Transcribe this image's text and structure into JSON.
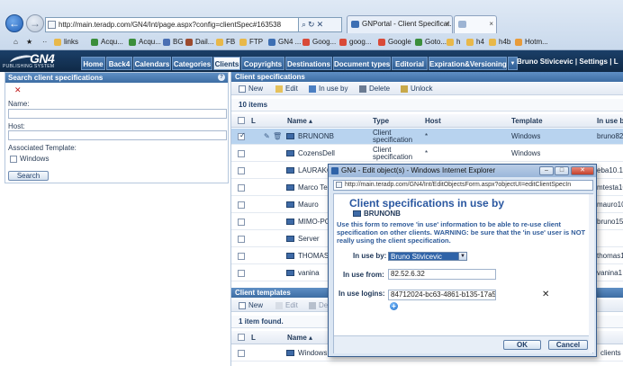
{
  "browser": {
    "address": "http://main.teradp.com/GN4/Int/page.aspx?config=clientSpec#163538",
    "tabs": [
      {
        "label": "GNPortal - Client Specificat...",
        "close": "×"
      },
      {
        "label": "",
        "close": "×"
      }
    ],
    "bookmarks": [
      "links",
      "Acqu...",
      "Acqu...",
      "BG",
      "Dail...",
      "FB",
      "FTP",
      "GN4 ...",
      "Goog...",
      "goog...",
      "Google",
      "Goto...",
      "h",
      "h4",
      "h4b",
      "Hotm..."
    ],
    "colors": {
      "chrome": "#c9d9ec",
      "address_border": "#7f9db9"
    }
  },
  "app": {
    "logo": {
      "title": "GN4",
      "subtitle": "PUBLISHING SYSTEM"
    },
    "nav_tabs": [
      "Home",
      "Back4",
      "Calendars",
      "Categories",
      "Clients",
      "Copyrights",
      "Destinations",
      "Document types",
      "Editorial",
      "Expiration&Versioning",
      "▼"
    ],
    "selected_tab": "Clients",
    "user": {
      "name": "Bruno Stivicevic",
      "sep": "|",
      "settings": "Settings",
      "sep2": "|",
      "more": "L"
    },
    "colors": {
      "header": "#0f2946",
      "panel_title": "#3d6da3",
      "selection": "#b8d3ef"
    }
  },
  "search_panel": {
    "title": "Search client specifications",
    "name_label": "Name:",
    "host_label": "Host:",
    "template_label": "Associated Template:",
    "template_option": "Windows",
    "search_button": "Search"
  },
  "client_specs": {
    "title": "Client specifications",
    "toolbar": {
      "new": "New",
      "edit": "Edit",
      "in_use_by": "In use by",
      "delete": "Delete",
      "unlock": "Unlock"
    },
    "count": "10 items",
    "columns": {
      "l": "L",
      "name": "Name ▴",
      "type": "Type",
      "host": "Host",
      "template": "Template",
      "in_use_by": "In use by"
    },
    "rows": [
      {
        "name": "BRUNONB",
        "type": "Client specification",
        "host": "*",
        "template": "Windows",
        "in_use": "bruno82..."
      },
      {
        "name": "CozensDell",
        "type": "Client specification",
        "host": "*",
        "template": "Windows",
        "in_use": ""
      },
      {
        "name": "LAURAKOV",
        "type": "",
        "host": "",
        "template": "",
        "in_use": "eba10.1"
      },
      {
        "name": "Marco Tes",
        "type": "",
        "host": "",
        "template": "",
        "in_use": "mtesta10"
      },
      {
        "name": "Mauro",
        "type": "",
        "host": "",
        "template": "",
        "in_use": "mauro10"
      },
      {
        "name": "MIMO-PC",
        "type": "",
        "host": "",
        "template": "",
        "in_use": "bruno151"
      },
      {
        "name": "Server",
        "type": "",
        "host": "",
        "template": "",
        "in_use": ""
      },
      {
        "name": "THOMASD",
        "type": "",
        "host": "",
        "template": "",
        "in_use": "thomas1"
      },
      {
        "name": "vanina",
        "type": "",
        "host": "",
        "template": "",
        "in_use": "vanina1"
      }
    ]
  },
  "client_templates": {
    "title": "Client templates",
    "toolbar": {
      "new": "New",
      "edit": "Edit",
      "delete": "De"
    },
    "count": "1 item found.",
    "columns": {
      "l": "L",
      "name": "Name ▴"
    },
    "rows": [
      {
        "name": "Windows",
        "extra": "clients"
      }
    ]
  },
  "dialog": {
    "window_title": "GN4 - Edit object(s) - Windows Internet Explorer",
    "address": "http://main.teradp.com/GN4/Int/EditObjectsForm.aspx?objectUI=editClientSpecIn",
    "heading": "Client specifications in use by",
    "subject": "BRUNONB",
    "note": "Use this form to remove 'in use' information to be able to re-use client specification on other clients. WARNING: be sure that the 'in use' user is NOT really using the client specification.",
    "in_use_by_label": "In use by:",
    "in_use_by_value": "Bruno Stivicevic",
    "in_use_from_label": "In use from:",
    "in_use_from_value": "82.52.6.32",
    "in_use_logins_label": "In use logins:",
    "in_use_logins_value": "84712024-bc63-4861-b135-17a575",
    "remove_symbol": "✕",
    "add_symbol": "+",
    "ok": "OK",
    "cancel": "Cancel"
  }
}
